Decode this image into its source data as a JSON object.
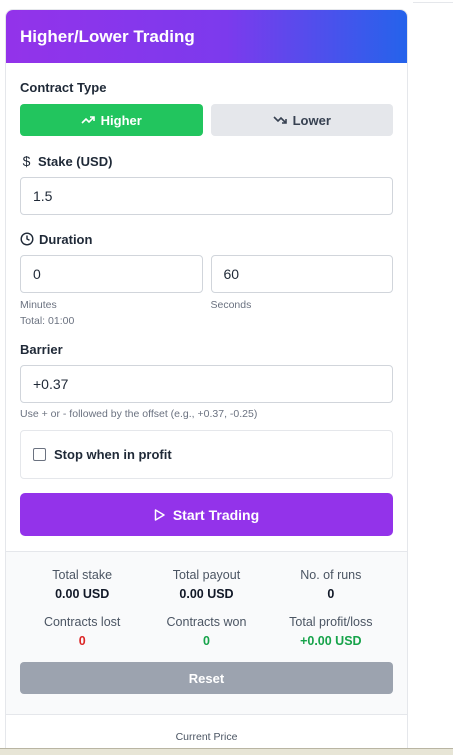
{
  "header": {
    "title": "Higher/Lower Trading"
  },
  "contract": {
    "label": "Contract Type",
    "higher_label": "Higher",
    "lower_label": "Lower",
    "selected": "Higher"
  },
  "stake": {
    "label": "Stake (USD)",
    "value": "1.5"
  },
  "duration": {
    "label": "Duration",
    "minutes_value": "0",
    "minutes_hint": "Minutes",
    "seconds_value": "60",
    "seconds_hint": "Seconds",
    "total": "Total: 01:00"
  },
  "barrier": {
    "label": "Barrier",
    "value": "+0.37",
    "hint": "Use + or - followed by the offset (e.g., +0.37, -0.25)"
  },
  "stop": {
    "label": "Stop when in profit",
    "checked": false
  },
  "start_button": {
    "label": "Start Trading"
  },
  "stats": {
    "total_stake_label": "Total stake",
    "total_stake_value": "0.00 USD",
    "total_payout_label": "Total payout",
    "total_payout_value": "0.00 USD",
    "runs_label": "No. of runs",
    "runs_value": "0",
    "lost_label": "Contracts lost",
    "lost_value": "0",
    "won_label": "Contracts won",
    "won_value": "0",
    "pl_label": "Total profit/loss",
    "pl_value": "+0.00 USD"
  },
  "reset_button": {
    "label": "Reset"
  },
  "current_price": {
    "label": "Current Price"
  },
  "colors": {
    "header_gradient_start": "#9333ea",
    "header_gradient_end": "#2563eb",
    "higher": "#22c55e",
    "start": "#9333ea",
    "loss": "#dc2626",
    "profit": "#16a34a"
  },
  "icons": {
    "higher": "trending-up-icon",
    "lower": "trending-down-icon",
    "stake": "dollar-icon",
    "duration": "clock-icon",
    "start": "play-icon"
  }
}
